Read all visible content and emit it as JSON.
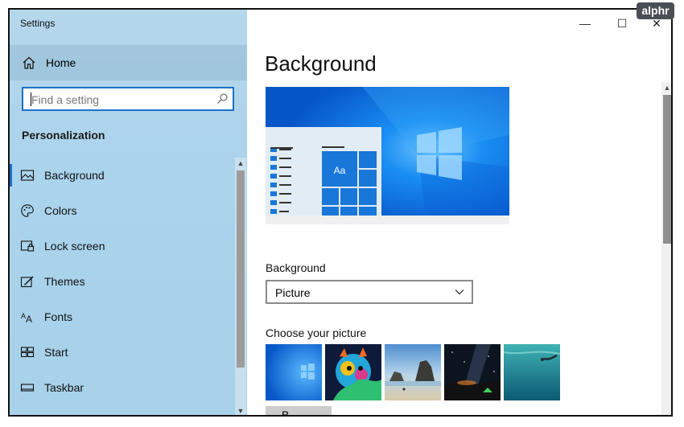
{
  "app": {
    "title": "Settings"
  },
  "window_controls": {
    "minimize": "—",
    "maximize": "☐",
    "close": "✕"
  },
  "sidebar": {
    "home_label": "Home",
    "search_placeholder": "Find a setting",
    "section_title": "Personalization",
    "items": [
      {
        "label": "Background",
        "icon": "picture-icon",
        "selected": true
      },
      {
        "label": "Colors",
        "icon": "palette-icon"
      },
      {
        "label": "Lock screen",
        "icon": "lock-screen-icon"
      },
      {
        "label": "Themes",
        "icon": "themes-brush-icon"
      },
      {
        "label": "Fonts",
        "icon": "fonts-icon"
      },
      {
        "label": "Start",
        "icon": "start-tiles-icon"
      },
      {
        "label": "Taskbar",
        "icon": "taskbar-icon"
      }
    ]
  },
  "main": {
    "title": "Background",
    "preview_tile_text": "Aa",
    "background_label": "Background",
    "background_value": "Picture",
    "choose_label": "Choose your picture",
    "browse_label": "B..."
  },
  "logo": {
    "text": "alphr"
  },
  "colors": {
    "accent": "#1e6fc7",
    "sidebar_bg": "#aad3ec",
    "preview_blue": "#0a6ee0"
  }
}
